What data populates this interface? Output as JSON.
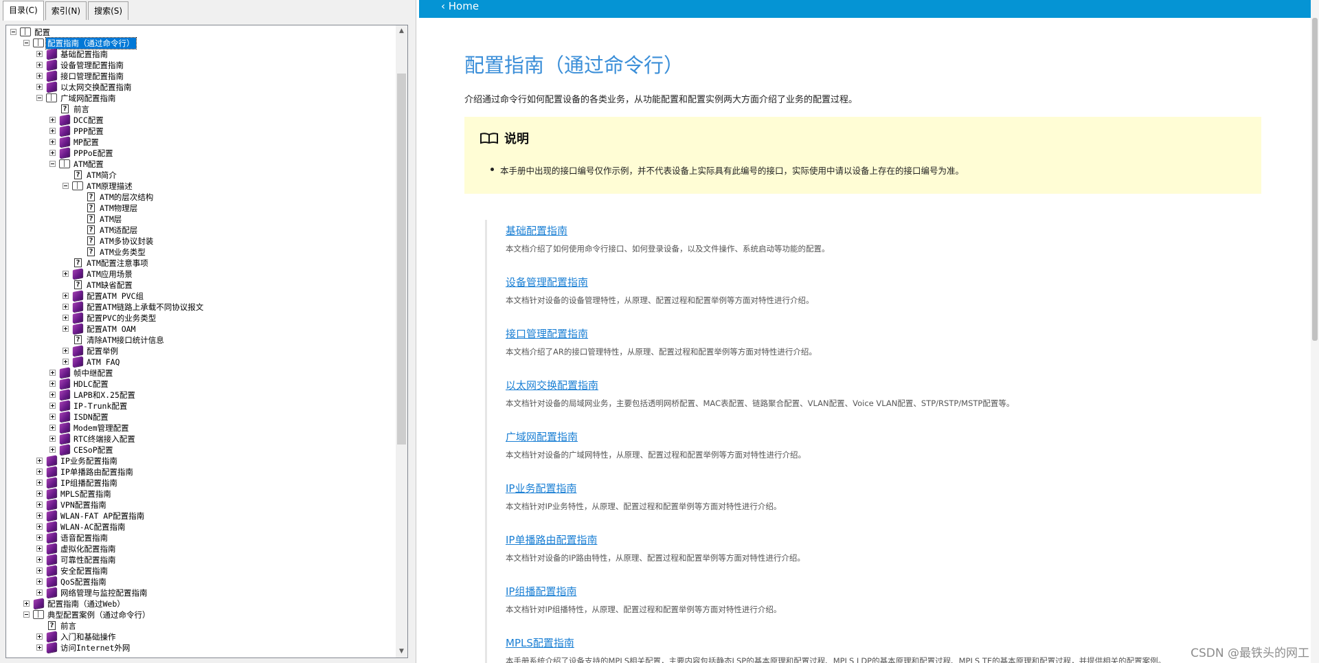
{
  "tabs": [
    "目录(C)",
    "索引(N)",
    "搜索(S)"
  ],
  "tree": [
    {
      "level": 0,
      "exp": "minus",
      "icon": "open",
      "label": "配置"
    },
    {
      "level": 1,
      "exp": "minus",
      "icon": "open",
      "label": "配置指南（通过命令行）",
      "selected": true
    },
    {
      "level": 2,
      "exp": "plus",
      "icon": "book",
      "label": "基础配置指南"
    },
    {
      "level": 2,
      "exp": "plus",
      "icon": "book",
      "label": "设备管理配置指南"
    },
    {
      "level": 2,
      "exp": "plus",
      "icon": "book",
      "label": "接口管理配置指南"
    },
    {
      "level": 2,
      "exp": "plus",
      "icon": "book",
      "label": "以太网交换配置指南"
    },
    {
      "level": 2,
      "exp": "minus",
      "icon": "open",
      "label": "广域网配置指南"
    },
    {
      "level": 3,
      "exp": "",
      "icon": "page",
      "label": "前言"
    },
    {
      "level": 3,
      "exp": "plus",
      "icon": "book",
      "label": "DCC配置"
    },
    {
      "level": 3,
      "exp": "plus",
      "icon": "book",
      "label": "PPP配置"
    },
    {
      "level": 3,
      "exp": "plus",
      "icon": "book",
      "label": "MP配置"
    },
    {
      "level": 3,
      "exp": "plus",
      "icon": "book",
      "label": "PPPoE配置"
    },
    {
      "level": 3,
      "exp": "minus",
      "icon": "open",
      "label": "ATM配置"
    },
    {
      "level": 4,
      "exp": "",
      "icon": "page",
      "label": "ATM简介"
    },
    {
      "level": 4,
      "exp": "minus",
      "icon": "open",
      "label": "ATM原理描述"
    },
    {
      "level": 5,
      "exp": "",
      "icon": "page",
      "label": "ATM的层次结构"
    },
    {
      "level": 5,
      "exp": "",
      "icon": "page",
      "label": "ATM物理层"
    },
    {
      "level": 5,
      "exp": "",
      "icon": "page",
      "label": "ATM层"
    },
    {
      "level": 5,
      "exp": "",
      "icon": "page",
      "label": "ATM适配层"
    },
    {
      "level": 5,
      "exp": "",
      "icon": "page",
      "label": "ATM多协议封装"
    },
    {
      "level": 5,
      "exp": "",
      "icon": "page",
      "label": "ATM业务类型"
    },
    {
      "level": 4,
      "exp": "",
      "icon": "page",
      "label": "ATM配置注意事项"
    },
    {
      "level": 4,
      "exp": "plus",
      "icon": "book",
      "label": "ATM应用场景"
    },
    {
      "level": 4,
      "exp": "",
      "icon": "page",
      "label": "ATM缺省配置"
    },
    {
      "level": 4,
      "exp": "plus",
      "icon": "book",
      "label": "配置ATM PVC组"
    },
    {
      "level": 4,
      "exp": "plus",
      "icon": "book",
      "label": "配置ATM链路上承载不同协议报文"
    },
    {
      "level": 4,
      "exp": "plus",
      "icon": "book",
      "label": "配置PVC的业务类型"
    },
    {
      "level": 4,
      "exp": "plus",
      "icon": "book",
      "label": "配置ATM OAM"
    },
    {
      "level": 4,
      "exp": "",
      "icon": "page",
      "label": "清除ATM接口统计信息"
    },
    {
      "level": 4,
      "exp": "plus",
      "icon": "book",
      "label": "配置举例"
    },
    {
      "level": 4,
      "exp": "plus",
      "icon": "book",
      "label": "ATM FAQ"
    },
    {
      "level": 3,
      "exp": "plus",
      "icon": "book",
      "label": "帧中继配置"
    },
    {
      "level": 3,
      "exp": "plus",
      "icon": "book",
      "label": "HDLC配置"
    },
    {
      "level": 3,
      "exp": "plus",
      "icon": "book",
      "label": "LAPB和X.25配置"
    },
    {
      "level": 3,
      "exp": "plus",
      "icon": "book",
      "label": "IP-Trunk配置"
    },
    {
      "level": 3,
      "exp": "plus",
      "icon": "book",
      "label": "ISDN配置"
    },
    {
      "level": 3,
      "exp": "plus",
      "icon": "book",
      "label": "Modem管理配置"
    },
    {
      "level": 3,
      "exp": "plus",
      "icon": "book",
      "label": "RTC终端接入配置"
    },
    {
      "level": 3,
      "exp": "plus",
      "icon": "book",
      "label": "CESoP配置"
    },
    {
      "level": 2,
      "exp": "plus",
      "icon": "book",
      "label": "IP业务配置指南"
    },
    {
      "level": 2,
      "exp": "plus",
      "icon": "book",
      "label": "IP单播路由配置指南"
    },
    {
      "level": 2,
      "exp": "plus",
      "icon": "book",
      "label": "IP组播配置指南"
    },
    {
      "level": 2,
      "exp": "plus",
      "icon": "book",
      "label": "MPLS配置指南"
    },
    {
      "level": 2,
      "exp": "plus",
      "icon": "book",
      "label": "VPN配置指南"
    },
    {
      "level": 2,
      "exp": "plus",
      "icon": "book",
      "label": "WLAN-FAT AP配置指南"
    },
    {
      "level": 2,
      "exp": "plus",
      "icon": "book",
      "label": "WLAN-AC配置指南"
    },
    {
      "level": 2,
      "exp": "plus",
      "icon": "book",
      "label": "语音配置指南"
    },
    {
      "level": 2,
      "exp": "plus",
      "icon": "book",
      "label": "虚拟化配置指南"
    },
    {
      "level": 2,
      "exp": "plus",
      "icon": "book",
      "label": "可靠性配置指南"
    },
    {
      "level": 2,
      "exp": "plus",
      "icon": "book",
      "label": "安全配置指南"
    },
    {
      "level": 2,
      "exp": "plus",
      "icon": "book",
      "label": "QoS配置指南"
    },
    {
      "level": 2,
      "exp": "plus",
      "icon": "book",
      "label": "网络管理与监控配置指南"
    },
    {
      "level": 1,
      "exp": "plus",
      "icon": "book",
      "label": "配置指南（通过Web）"
    },
    {
      "level": 1,
      "exp": "minus",
      "icon": "open",
      "label": "典型配置案例（通过命令行）"
    },
    {
      "level": 2,
      "exp": "",
      "icon": "page",
      "label": "前言"
    },
    {
      "level": 2,
      "exp": "plus",
      "icon": "book",
      "label": "入门和基础操作"
    },
    {
      "level": 2,
      "exp": "plus",
      "icon": "book",
      "label": "访问Internet外网"
    }
  ],
  "content": {
    "home": "Home",
    "title": "配置指南（通过命令行）",
    "intro": "介绍通过命令行如何配置设备的各类业务，从功能配置和配置实例两大方面介绍了业务的配置过程。",
    "note_title": "说明",
    "note_text": "本手册中出现的接口编号仅作示例，并不代表设备上实际具有此编号的接口，实际使用中请以设备上存在的接口编号为准。",
    "items": [
      {
        "title": "基础配置指南",
        "desc": "本文档介绍了如何使用命令行接口、如何登录设备，以及文件操作、系统启动等功能的配置。"
      },
      {
        "title": "设备管理配置指南",
        "desc": "本文档针对设备的设备管理特性，从原理、配置过程和配置举例等方面对特性进行介绍。"
      },
      {
        "title": "接口管理配置指南",
        "desc": "本文档介绍了AR的接口管理特性，从原理、配置过程和配置举例等方面对特性进行介绍。"
      },
      {
        "title": "以太网交换配置指南",
        "desc": "本文档针对设备的局域网业务，主要包括透明网桥配置、MAC表配置、链路聚合配置、VLAN配置、Voice VLAN配置、STP/RSTP/MSTP配置等。"
      },
      {
        "title": "广域网配置指南",
        "desc": "本文档针对设备的广域网特性，从原理、配置过程和配置举例等方面对特性进行介绍。"
      },
      {
        "title": "IP业务配置指南",
        "desc": "本文档针对IP业务特性，从原理、配置过程和配置举例等方面对特性进行介绍。"
      },
      {
        "title": "IP单播路由配置指南",
        "desc": "本文档针对设备的IP路由特性，从原理、配置过程和配置举例等方面对特性进行介绍。"
      },
      {
        "title": "IP组播配置指南",
        "desc": "本文档针对IP组播特性，从原理、配置过程和配置举例等方面对特性进行介绍。"
      },
      {
        "title": "MPLS配置指南",
        "desc": "本手册系统介绍了设备支持的MPLS相关配置，主要内容包括静态LSP的基本原理和配置过程、MPLS LDP的基本原理和配置过程、MPLS TE的基本原理和配置过程，并提供相关的配置案例。"
      }
    ]
  },
  "watermark": "CSDN @最铁头的网工"
}
